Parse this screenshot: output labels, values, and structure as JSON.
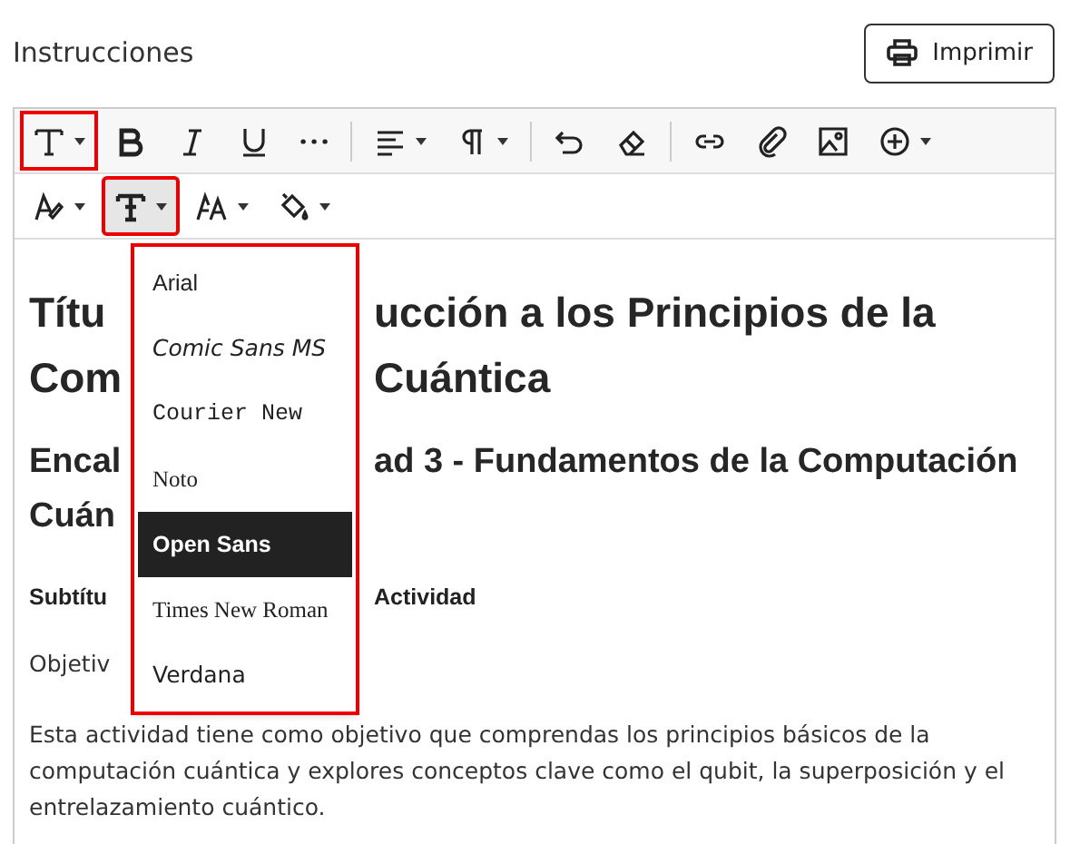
{
  "header": {
    "title": "Instrucciones",
    "print_button": "Imprimir"
  },
  "toolbar": {
    "rows": [
      [
        {
          "kind": "text-style",
          "caret": true,
          "highlighted": true,
          "active": false
        },
        {
          "kind": "bold",
          "caret": false,
          "highlighted": false,
          "active": false
        },
        {
          "kind": "italic",
          "caret": false,
          "highlighted": false,
          "active": false
        },
        {
          "kind": "underline",
          "caret": false,
          "highlighted": false,
          "active": false
        },
        {
          "kind": "more",
          "caret": false,
          "highlighted": false,
          "active": false
        },
        {
          "kind": "separator"
        },
        {
          "kind": "align",
          "caret": true,
          "highlighted": false,
          "active": false
        },
        {
          "kind": "paragraph",
          "caret": true,
          "highlighted": false,
          "active": false
        },
        {
          "kind": "separator"
        },
        {
          "kind": "undo",
          "caret": false,
          "highlighted": false,
          "active": false
        },
        {
          "kind": "eraser",
          "caret": false,
          "highlighted": false,
          "active": false
        },
        {
          "kind": "separator"
        },
        {
          "kind": "link",
          "caret": false,
          "highlighted": false,
          "active": false
        },
        {
          "kind": "attach",
          "caret": false,
          "highlighted": false,
          "active": false
        },
        {
          "kind": "image",
          "caret": false,
          "highlighted": false,
          "active": false
        },
        {
          "kind": "insert",
          "caret": true,
          "highlighted": false,
          "active": false
        }
      ],
      [
        {
          "kind": "pen",
          "caret": true,
          "highlighted": false,
          "active": false
        },
        {
          "kind": "font",
          "caret": true,
          "highlighted": true,
          "active": true
        },
        {
          "kind": "size",
          "caret": true,
          "highlighted": false,
          "active": false
        },
        {
          "kind": "fill",
          "caret": true,
          "highlighted": false,
          "active": false
        }
      ]
    ]
  },
  "content": [
    {
      "kind": "h1",
      "left": "Títu",
      "right": "ucción a los Principios de la"
    },
    {
      "kind": "h1",
      "left": "Com",
      "right": "Cuántica"
    },
    {
      "kind": "h2",
      "left": "Encal",
      "right": "ad 3 - Fundamentos de la Computación"
    },
    {
      "kind": "h2",
      "left": "Cuán"
    },
    {
      "kind": "bold",
      "left": "Subtítu",
      "right": "Actividad"
    },
    {
      "kind": "text",
      "left": "Objetiv"
    },
    {
      "kind": "para",
      "left": "Esta actividad tiene como objetivo que comprendas los principios básicos de la computación cuántica y explores conceptos clave como el qubit, la superposición y el entrelazamiento cuántico."
    }
  ],
  "font_menu": {
    "highlighted": true,
    "items": [
      {
        "label": "Arial",
        "selected": false
      },
      {
        "label": "Comic Sans MS",
        "selected": false
      },
      {
        "label": "Courier New",
        "selected": false
      },
      {
        "label": "Noto",
        "selected": false
      },
      {
        "label": "Open Sans",
        "selected": true
      },
      {
        "label": "Times New Roman",
        "selected": false
      },
      {
        "label": "Verdana",
        "selected": false
      }
    ]
  }
}
